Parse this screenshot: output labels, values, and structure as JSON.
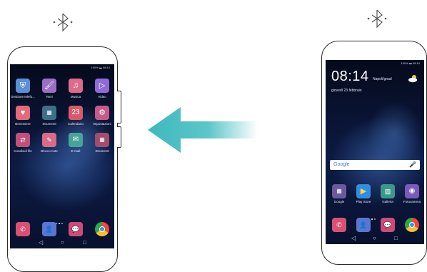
{
  "icons": {
    "left_bluetooth": "bluetooth-icon",
    "right_bluetooth": "bluetooth-icon",
    "transfer_arrow": "arrow-left-icon"
  },
  "colors": {
    "arrow": "#3db9bd",
    "screen_bg": "#0a1434",
    "phone_frame": "#2b2b2b"
  },
  "left_phone": {
    "status": "100% ▬ 08:14",
    "apps": [
      {
        "label": "Gestione telefo...",
        "icon": "shield-icon",
        "color": "#5b8fd6"
      },
      {
        "label": "Temi",
        "icon": "brush-icon",
        "color": "#9b6fc4"
      },
      {
        "label": "Musica",
        "icon": "music-note-icon",
        "color": "#e06a8c"
      },
      {
        "label": "Video",
        "icon": "play-icon",
        "color": "#8f6ad8"
      },
      {
        "label": "Benessere",
        "icon": "heart-icon",
        "color": "#e46a7a"
      },
      {
        "label": "Strumenti",
        "icon": "tools-folder-icon",
        "color": "#3d6f86"
      },
      {
        "label": "Calendario",
        "icon": "calendar-icon",
        "color": "#d85a6a",
        "value": "23"
      },
      {
        "label": "Impostazioni",
        "icon": "gear-icon",
        "color": "#c85a8a"
      },
      {
        "label": "Condividi file",
        "icon": "share-icon",
        "color": "#c0507a"
      },
      {
        "label": "Blocco note",
        "icon": "notepad-icon",
        "color": "#d86a8a"
      },
      {
        "label": "E-mail",
        "icon": "email-icon",
        "color": "#4aa39a"
      },
      {
        "label": "Strumenti",
        "icon": "folder-icon",
        "color": "#a14d6e"
      }
    ],
    "dock": [
      {
        "icon": "phone-icon",
        "color": "#d85073"
      },
      {
        "icon": "contacts-icon",
        "color": "#5a76d0"
      },
      {
        "icon": "messages-icon",
        "color": "#d04a78"
      },
      {
        "icon": "chrome-icon",
        "color": "#e94b3c"
      }
    ],
    "nav": [
      "◁",
      "○",
      "□"
    ]
  },
  "right_phone": {
    "status": "100% ▬ 08:14",
    "time": "08:14",
    "location": "Napoli/gnad",
    "date": "giovedì 23 febbraio",
    "search_label": "Google",
    "apps": [
      {
        "label": "Google",
        "icon": "google-folder-icon",
        "color": "#6a5a9a"
      },
      {
        "label": "Play Store",
        "icon": "play-store-icon",
        "color": "#2f8ee0"
      },
      {
        "label": "Galleria",
        "icon": "gallery-icon",
        "color": "#3a9a8a"
      },
      {
        "label": "Fotocamera",
        "icon": "camera-icon",
        "color": "#7a5ab8"
      }
    ],
    "dock": [
      {
        "icon": "phone-icon",
        "color": "#d85073"
      },
      {
        "icon": "contacts-icon",
        "color": "#5a76d0"
      },
      {
        "icon": "messages-icon",
        "color": "#d04a78"
      },
      {
        "icon": "chrome-icon",
        "color": "#e94b3c"
      }
    ],
    "nav": [
      "◁",
      "○",
      "□"
    ]
  }
}
